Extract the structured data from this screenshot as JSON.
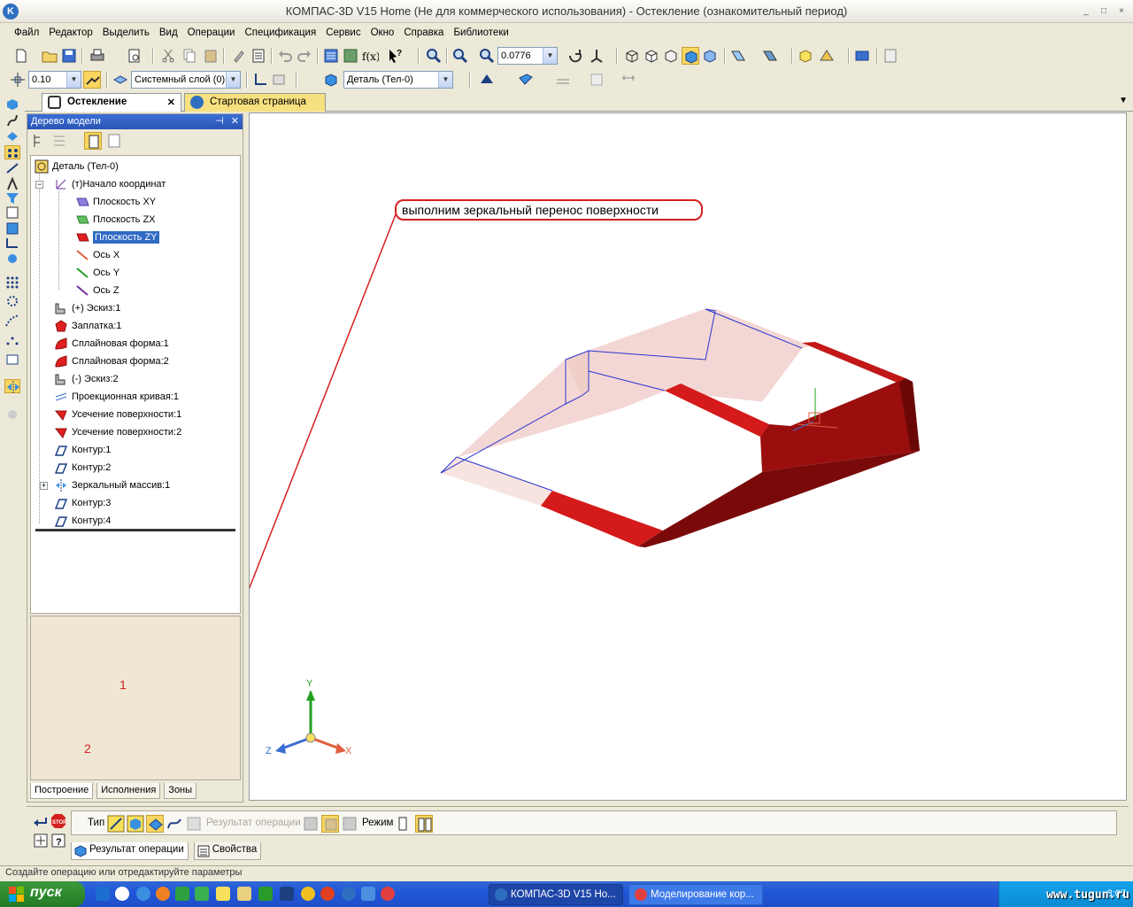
{
  "window": {
    "title": "КОМПАС-3D V15 Home (Не для коммерческого использования) - Остекление (ознакомительный период)",
    "controls": [
      "_",
      "□",
      "×"
    ]
  },
  "menu": [
    "Файл",
    "Редактор",
    "Выделить",
    "Вид",
    "Операции",
    "Спецификация",
    "Сервис",
    "Окно",
    "Справка",
    "Библиотеки"
  ],
  "toolbar1": {
    "zoom_value": "0.0776"
  },
  "toolbar2": {
    "step_value": "0.10",
    "layer_value": "Системный слой (0)",
    "part_value": "Деталь (Тел-0)"
  },
  "tabs": {
    "active": "Остекление",
    "inactive": "Стартовая страница"
  },
  "tree": {
    "title": "Дерево модели",
    "items": [
      "Деталь (Тел-0)",
      "(т)Начало координат",
      "Плоскость XY",
      "Плоскость ZX",
      "Плоскость ZY",
      "Ось X",
      "Ось Y",
      "Ось Z",
      "(+) Эскиз:1",
      "Заплатка:1",
      "Сплайновая форма:1",
      "Сплайновая форма:2",
      "(-) Эскиз:2",
      "Проекционная кривая:1",
      "Усечение поверхности:1",
      "Усечение поверхности:2",
      "Контур:1",
      "Контур:2",
      "Зеркальный массив:1",
      "Контур:3",
      "Контур:4"
    ],
    "bottom_tabs": [
      "Построение",
      "Исполнения",
      "Зоны"
    ]
  },
  "viewport": {
    "callout": "выполним зеркальный перенос поверхности",
    "axes": {
      "x": "X",
      "y": "Y",
      "z": "Z"
    },
    "annotations": [
      "1",
      "2"
    ]
  },
  "properties": {
    "type_label": "Тип",
    "result_label": "Результат операции",
    "mode_label": "Режим",
    "tabs": [
      "Результат операции",
      "Свойства"
    ]
  },
  "status": "Создайте операцию или отредактируйте параметры",
  "taskbar": {
    "start": "пуск",
    "tasks": [
      "КОМПАС-3D V15 Ho...",
      "Моделирование кор..."
    ],
    "lang": "RL",
    "clock": "8:07",
    "watermark": "www.tugun.ru"
  },
  "colors": {
    "accent": "#316ac5",
    "surface_red": "#d41a1a",
    "surface_dark": "#7a0a0a",
    "callout_border": "#d52020"
  }
}
